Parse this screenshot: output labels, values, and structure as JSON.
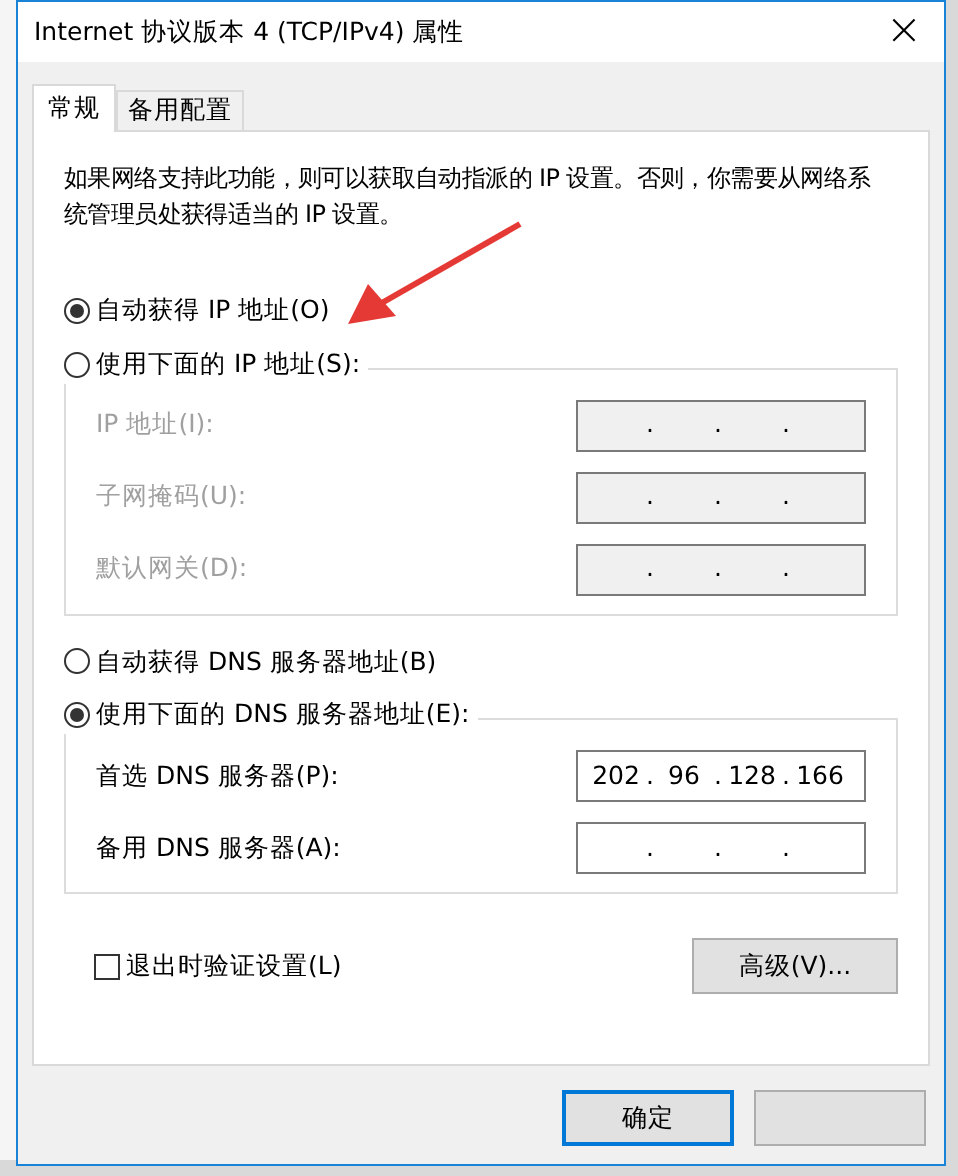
{
  "window": {
    "title": "Internet 协议版本 4 (TCP/IPv4) 属性",
    "close": "×"
  },
  "tabs": [
    {
      "label": "常规",
      "selected": true
    },
    {
      "label": "备用配置",
      "selected": false
    }
  ],
  "description": "如果网络支持此功能，则可以获取自动指派的 IP 设置。否则，你需要从网络系统管理员处获得适当的 IP 设置。",
  "ip_section": {
    "auto_option": {
      "label": "自动获得 IP 地址(O)",
      "selected": true
    },
    "manual_option": {
      "label": "使用下面的 IP 地址(S):",
      "selected": false
    },
    "disabled": true,
    "fields": [
      {
        "label": "IP 地址(I):",
        "dots": [
          ".",
          ".",
          "."
        ]
      },
      {
        "label": "子网掩码(U):",
        "dots": [
          ".",
          ".",
          "."
        ]
      },
      {
        "label": "默认网关(D):",
        "dots": [
          ".",
          ".",
          "."
        ]
      }
    ]
  },
  "dns_section": {
    "auto_option": {
      "label": "自动获得 DNS 服务器地址(B)",
      "selected": false
    },
    "manual_option": {
      "label": "使用下面的 DNS 服务器地址(E):",
      "selected": true
    },
    "disabled": false,
    "fields": [
      {
        "label": "首选 DNS 服务器(P):",
        "octets": [
          "202",
          "96",
          "128",
          "166"
        ],
        "dots": [
          ".",
          ".",
          "."
        ]
      },
      {
        "label": "备用 DNS 服务器(A):",
        "dots": [
          ".",
          ".",
          "."
        ]
      }
    ]
  },
  "validate_checkbox": {
    "label": "退出时验证设置(L)",
    "checked": false
  },
  "advanced_button": "高级(V)...",
  "buttons": [
    {
      "label": "确定",
      "focused": true
    },
    {
      "focused": false
    }
  ]
}
